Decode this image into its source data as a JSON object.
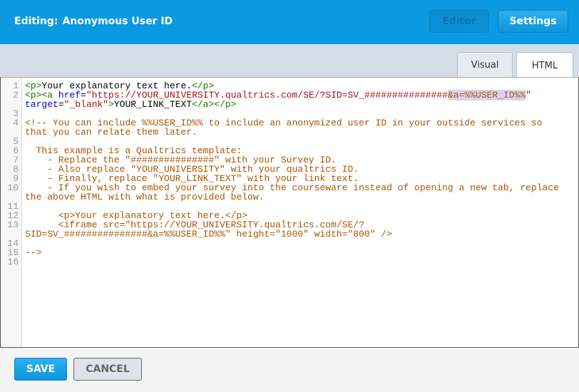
{
  "header": {
    "editing_label": "Editing:",
    "title": "Anonymous User ID",
    "editor_button": "Editor",
    "settings_button": "Settings"
  },
  "tabs": [
    {
      "label": "Visual",
      "active": false
    },
    {
      "label": "HTML",
      "active": true
    }
  ],
  "code_lines": [
    {
      "n": "1",
      "rows": [
        [
          [
            "tag",
            "<p>"
          ],
          [
            "text",
            "Your explanatory text here."
          ],
          [
            "tag",
            "</p>"
          ]
        ]
      ]
    },
    {
      "n": "2",
      "rows": [
        [
          [
            "tag",
            "<p><a "
          ],
          [
            "attr",
            "href"
          ],
          [
            "text",
            "="
          ],
          [
            "string",
            "\"https://YOUR_UNIVERSITY.qualtrics.com/SE/?SID=SV_###############"
          ],
          [
            "hl",
            "&a=%%USER_ID%%"
          ],
          [
            "string",
            "\""
          ]
        ],
        [
          [
            "attr",
            "target"
          ],
          [
            "text",
            "="
          ],
          [
            "string",
            "\"_blank\""
          ],
          [
            "tag",
            ">"
          ],
          [
            "text",
            "YOUR_LINK_TEXT"
          ],
          [
            "tag",
            "</a></p>"
          ]
        ]
      ]
    },
    {
      "n": "3",
      "rows": [
        []
      ]
    },
    {
      "n": "4",
      "rows": [
        [
          [
            "comment",
            "<!-- You can include %%USER_ID%% to include an anonymized user ID in your outside services so"
          ]
        ],
        [
          [
            "comment",
            "that you can relate them later."
          ]
        ]
      ]
    },
    {
      "n": "5",
      "rows": [
        []
      ]
    },
    {
      "n": "6",
      "rows": [
        [
          [
            "comment",
            "  This example is a Qualtrics template:"
          ]
        ]
      ]
    },
    {
      "n": "7",
      "rows": [
        [
          [
            "comment",
            "    - Replace the \"###############\" with your Survey ID."
          ]
        ]
      ]
    },
    {
      "n": "8",
      "rows": [
        [
          [
            "comment",
            "    - Also replace \"YOUR_UNIVERSITY\" with your qualtrics ID."
          ]
        ]
      ]
    },
    {
      "n": "9",
      "rows": [
        [
          [
            "comment",
            "    - Finally, replace \"YOUR_LINK_TEXT\" with your link text."
          ]
        ]
      ]
    },
    {
      "n": "10",
      "rows": [
        [
          [
            "comment",
            "    - If you wish to embed your survey into the courseware instead of opening a new tab, replace"
          ]
        ],
        [
          [
            "comment",
            "the above HTML with what is provided below."
          ]
        ]
      ]
    },
    {
      "n": "11",
      "rows": [
        []
      ]
    },
    {
      "n": "12",
      "rows": [
        [
          [
            "comment",
            "      <p>Your explanatory text here.</p>"
          ]
        ]
      ]
    },
    {
      "n": "13",
      "rows": [
        [
          [
            "comment",
            "      <iframe src=\"https://YOUR_UNIVERSITY.qualtrics.com/SE/?"
          ]
        ],
        [
          [
            "comment",
            "SID=SV_###############&a=%%USER_ID%%\" height=\"1000\" width=\"800\" />"
          ]
        ]
      ]
    },
    {
      "n": "14",
      "rows": [
        []
      ]
    },
    {
      "n": "15",
      "rows": [
        [
          [
            "comment",
            "-->"
          ]
        ]
      ]
    },
    {
      "n": "16",
      "rows": [
        []
      ]
    }
  ],
  "footer": {
    "save_button": "SAVE",
    "cancel_button": "CANCEL"
  }
}
